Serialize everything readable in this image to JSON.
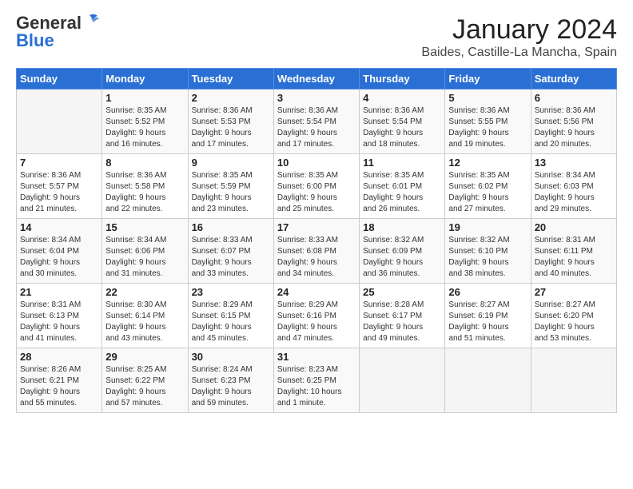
{
  "logo": {
    "general": "General",
    "blue": "Blue"
  },
  "title": "January 2024",
  "location": "Baides, Castille-La Mancha, Spain",
  "days_of_week": [
    "Sunday",
    "Monday",
    "Tuesday",
    "Wednesday",
    "Thursday",
    "Friday",
    "Saturday"
  ],
  "weeks": [
    [
      {
        "day": "",
        "info": ""
      },
      {
        "day": "1",
        "info": "Sunrise: 8:35 AM\nSunset: 5:52 PM\nDaylight: 9 hours\nand 16 minutes."
      },
      {
        "day": "2",
        "info": "Sunrise: 8:36 AM\nSunset: 5:53 PM\nDaylight: 9 hours\nand 17 minutes."
      },
      {
        "day": "3",
        "info": "Sunrise: 8:36 AM\nSunset: 5:54 PM\nDaylight: 9 hours\nand 17 minutes."
      },
      {
        "day": "4",
        "info": "Sunrise: 8:36 AM\nSunset: 5:54 PM\nDaylight: 9 hours\nand 18 minutes."
      },
      {
        "day": "5",
        "info": "Sunrise: 8:36 AM\nSunset: 5:55 PM\nDaylight: 9 hours\nand 19 minutes."
      },
      {
        "day": "6",
        "info": "Sunrise: 8:36 AM\nSunset: 5:56 PM\nDaylight: 9 hours\nand 20 minutes."
      }
    ],
    [
      {
        "day": "7",
        "info": "Sunrise: 8:36 AM\nSunset: 5:57 PM\nDaylight: 9 hours\nand 21 minutes."
      },
      {
        "day": "8",
        "info": "Sunrise: 8:36 AM\nSunset: 5:58 PM\nDaylight: 9 hours\nand 22 minutes."
      },
      {
        "day": "9",
        "info": "Sunrise: 8:35 AM\nSunset: 5:59 PM\nDaylight: 9 hours\nand 23 minutes."
      },
      {
        "day": "10",
        "info": "Sunrise: 8:35 AM\nSunset: 6:00 PM\nDaylight: 9 hours\nand 25 minutes."
      },
      {
        "day": "11",
        "info": "Sunrise: 8:35 AM\nSunset: 6:01 PM\nDaylight: 9 hours\nand 26 minutes."
      },
      {
        "day": "12",
        "info": "Sunrise: 8:35 AM\nSunset: 6:02 PM\nDaylight: 9 hours\nand 27 minutes."
      },
      {
        "day": "13",
        "info": "Sunrise: 8:34 AM\nSunset: 6:03 PM\nDaylight: 9 hours\nand 29 minutes."
      }
    ],
    [
      {
        "day": "14",
        "info": "Sunrise: 8:34 AM\nSunset: 6:04 PM\nDaylight: 9 hours\nand 30 minutes."
      },
      {
        "day": "15",
        "info": "Sunrise: 8:34 AM\nSunset: 6:06 PM\nDaylight: 9 hours\nand 31 minutes."
      },
      {
        "day": "16",
        "info": "Sunrise: 8:33 AM\nSunset: 6:07 PM\nDaylight: 9 hours\nand 33 minutes."
      },
      {
        "day": "17",
        "info": "Sunrise: 8:33 AM\nSunset: 6:08 PM\nDaylight: 9 hours\nand 34 minutes."
      },
      {
        "day": "18",
        "info": "Sunrise: 8:32 AM\nSunset: 6:09 PM\nDaylight: 9 hours\nand 36 minutes."
      },
      {
        "day": "19",
        "info": "Sunrise: 8:32 AM\nSunset: 6:10 PM\nDaylight: 9 hours\nand 38 minutes."
      },
      {
        "day": "20",
        "info": "Sunrise: 8:31 AM\nSunset: 6:11 PM\nDaylight: 9 hours\nand 40 minutes."
      }
    ],
    [
      {
        "day": "21",
        "info": "Sunrise: 8:31 AM\nSunset: 6:13 PM\nDaylight: 9 hours\nand 41 minutes."
      },
      {
        "day": "22",
        "info": "Sunrise: 8:30 AM\nSunset: 6:14 PM\nDaylight: 9 hours\nand 43 minutes."
      },
      {
        "day": "23",
        "info": "Sunrise: 8:29 AM\nSunset: 6:15 PM\nDaylight: 9 hours\nand 45 minutes."
      },
      {
        "day": "24",
        "info": "Sunrise: 8:29 AM\nSunset: 6:16 PM\nDaylight: 9 hours\nand 47 minutes."
      },
      {
        "day": "25",
        "info": "Sunrise: 8:28 AM\nSunset: 6:17 PM\nDaylight: 9 hours\nand 49 minutes."
      },
      {
        "day": "26",
        "info": "Sunrise: 8:27 AM\nSunset: 6:19 PM\nDaylight: 9 hours\nand 51 minutes."
      },
      {
        "day": "27",
        "info": "Sunrise: 8:27 AM\nSunset: 6:20 PM\nDaylight: 9 hours\nand 53 minutes."
      }
    ],
    [
      {
        "day": "28",
        "info": "Sunrise: 8:26 AM\nSunset: 6:21 PM\nDaylight: 9 hours\nand 55 minutes."
      },
      {
        "day": "29",
        "info": "Sunrise: 8:25 AM\nSunset: 6:22 PM\nDaylight: 9 hours\nand 57 minutes."
      },
      {
        "day": "30",
        "info": "Sunrise: 8:24 AM\nSunset: 6:23 PM\nDaylight: 9 hours\nand 59 minutes."
      },
      {
        "day": "31",
        "info": "Sunrise: 8:23 AM\nSunset: 6:25 PM\nDaylight: 10 hours\nand 1 minute."
      },
      {
        "day": "",
        "info": ""
      },
      {
        "day": "",
        "info": ""
      },
      {
        "day": "",
        "info": ""
      }
    ]
  ]
}
